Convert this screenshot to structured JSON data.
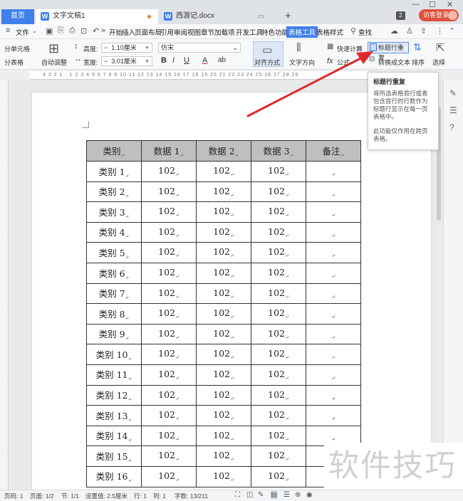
{
  "tabs": {
    "home": "首页",
    "active_doc": "文字文稿1",
    "other_doc": "西游记.docx",
    "new_tab": "+",
    "window_count": "2",
    "guest_login": "访客登录"
  },
  "menu": {
    "file": "文件",
    "items": [
      "开始",
      "插入",
      "页面布局",
      "引用",
      "审阅",
      "视图",
      "章节",
      "加载项",
      "开发工具",
      "特色功能",
      "表格工具",
      "表格样式"
    ],
    "selected": "表格工具",
    "search": "查找"
  },
  "ribbon": {
    "split_cells": "分单元格",
    "split_table": "分表格",
    "auto_fit": "自动调整",
    "height_label": "高度:",
    "height_value": "1.10厘米",
    "width_label": "宽度:",
    "width_value": "3.01厘米",
    "font_name": "仿宋",
    "align": "对齐方式",
    "text_direction": "文字方向",
    "quick_calc": "快速计算",
    "formula": "公式",
    "repeat_header": "标题行重复",
    "convert_text": "转换成文本",
    "sort": "排序",
    "select": "选择"
  },
  "tooltip": {
    "title": "标题行重复",
    "body1": "将所选表格首行或者包含首行的行数作为标题行显示在每一页表格中。",
    "body2": "此功能仅作用在跨页表格。"
  },
  "ruler": {
    "marks": "4 3 2 1 · 1 2 3 4 5 6 7 8 9 10 11 12 13 14 15 16 17 18 19 20 21 22 23 24 25 26 27 28 29"
  },
  "table": {
    "headers": [
      "类别",
      "数据 1",
      "数据 2",
      "数据 3",
      "备注"
    ],
    "rows": [
      [
        "类别 1",
        "102",
        "102",
        "102",
        ""
      ],
      [
        "类别 2",
        "102",
        "102",
        "102",
        ""
      ],
      [
        "类别 3",
        "102",
        "102",
        "102",
        ""
      ],
      [
        "类别 4",
        "102",
        "102",
        "102",
        ""
      ],
      [
        "类别 5",
        "102",
        "102",
        "102",
        ""
      ],
      [
        "类别 6",
        "102",
        "102",
        "102",
        ""
      ],
      [
        "类别 7",
        "102",
        "102",
        "102",
        ""
      ],
      [
        "类别 8",
        "102",
        "102",
        "102",
        ""
      ],
      [
        "类别 9",
        "102",
        "102",
        "102",
        ""
      ],
      [
        "类别 10",
        "102",
        "102",
        "102",
        ""
      ],
      [
        "类别 11",
        "102",
        "102",
        "102",
        ""
      ],
      [
        "类别 12",
        "102",
        "102",
        "102",
        ""
      ],
      [
        "类别 13",
        "102",
        "102",
        "102",
        ""
      ],
      [
        "类别 14",
        "102",
        "102",
        "102",
        ""
      ],
      [
        "类别 15",
        "102",
        "102",
        "102",
        ""
      ],
      [
        "类别 16",
        "102",
        "102",
        "102",
        ""
      ]
    ]
  },
  "watermark": "软件技巧",
  "status": {
    "page_no": "页码: 1",
    "pages": "页面: 1/2",
    "section": "节: 1/1",
    "setting": "设置值: 2.5厘米",
    "row": "行: 1",
    "col": "列: 1",
    "words": "字数: 13/211"
  },
  "colors": {
    "accent": "#3f80ea",
    "guest": "#e0503f",
    "arrow": "#e02a2a"
  }
}
